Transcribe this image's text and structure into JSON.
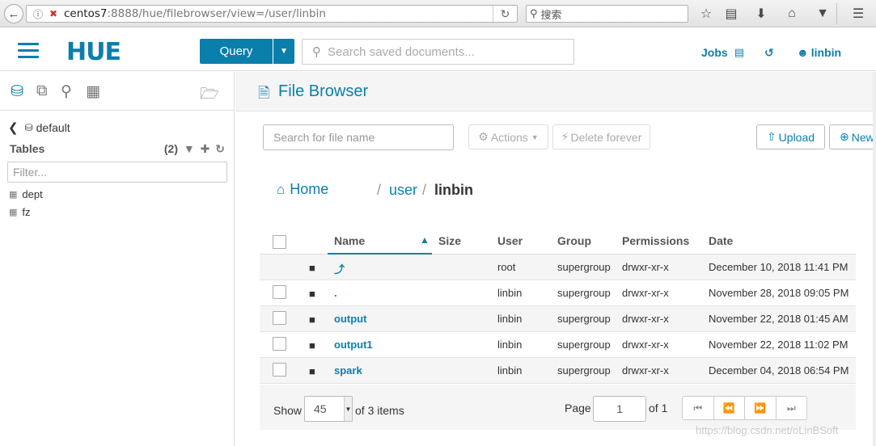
{
  "browser": {
    "url_host": "centos7",
    "url_rest": ":8888/hue/filebrowser/view=/user/linbin",
    "search_placeholder": "搜索"
  },
  "header": {
    "logo": "HUE",
    "query_label": "Query",
    "search_placeholder": "Search saved documents...",
    "jobs_label": "Jobs",
    "user_label": "linbin"
  },
  "sidebar": {
    "database": "default",
    "tables_label": "Tables",
    "tables_count": "(2)",
    "filter_placeholder": "Filter...",
    "tables": [
      "dept",
      "fz"
    ]
  },
  "main": {
    "title": "File Browser",
    "file_search_placeholder": "Search for file name",
    "actions_label": "Actions",
    "delete_label": "Delete forever",
    "upload_label": "Upload",
    "new_label": "New",
    "breadcrumb": {
      "home": "Home",
      "sep": "/",
      "user": "user",
      "current": "linbin"
    },
    "columns": {
      "name": "Name",
      "size": "Size",
      "user": "User",
      "group": "Group",
      "permissions": "Permissions",
      "date": "Date"
    },
    "rows": [
      {
        "name": "⤴",
        "user": "root",
        "group": "supergroup",
        "permissions": "drwxr-xr-x",
        "date": "December 10, 2018 11:41 PM"
      },
      {
        "name": ".",
        "user": "linbin",
        "group": "supergroup",
        "permissions": "drwxr-xr-x",
        "date": "November 28, 2018 09:05 PM"
      },
      {
        "name": "output",
        "user": "linbin",
        "group": "supergroup",
        "permissions": "drwxr-xr-x",
        "date": "November 22, 2018 01:45 AM"
      },
      {
        "name": "output1",
        "user": "linbin",
        "group": "supergroup",
        "permissions": "drwxr-xr-x",
        "date": "November 22, 2018 11:02 PM"
      },
      {
        "name": "spark",
        "user": "linbin",
        "group": "supergroup",
        "permissions": "drwxr-xr-x",
        "date": "December 04, 2018 06:54 PM"
      }
    ],
    "pager": {
      "show": "Show",
      "page_size": "45",
      "of_items": "of 3 items",
      "page": "Page",
      "page_value": "1",
      "of_pages": "of 1"
    }
  },
  "watermark": "https://blog.csdn.net/oLinBSoft",
  "colors": {
    "accent": "#0b7fab"
  }
}
